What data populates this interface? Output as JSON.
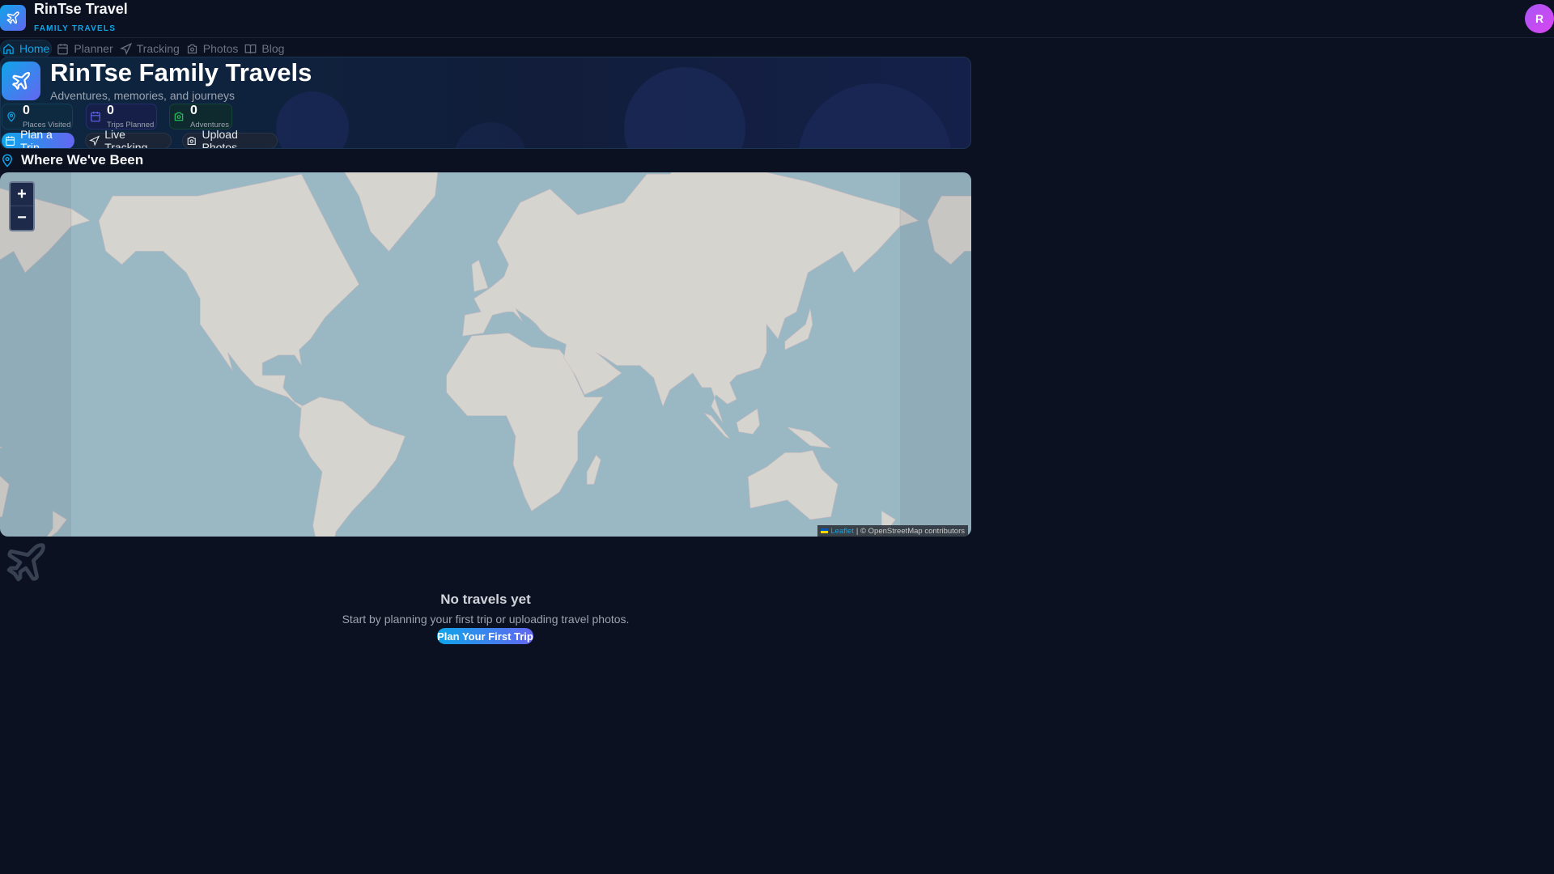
{
  "app": {
    "name": "RinTse Travel",
    "subtitle": "FAMILY TRAVELS",
    "avatar_initial": "R"
  },
  "nav": [
    {
      "label": "Home",
      "icon": "home-icon",
      "active": true
    },
    {
      "label": "Planner",
      "icon": "calendar-icon"
    },
    {
      "label": "Tracking",
      "icon": "navigation-icon"
    },
    {
      "label": "Photos",
      "icon": "camera-icon"
    },
    {
      "label": "Blog",
      "icon": "book-icon"
    }
  ],
  "hero": {
    "title": "RinTse Family Travels",
    "subtitle": "Adventures, memories, and journeys",
    "stats": [
      {
        "value": "0",
        "label": "Places Visited",
        "color": "#0ea5e9"
      },
      {
        "value": "0",
        "label": "Trips Planned",
        "color": "#6366f1"
      },
      {
        "value": "0",
        "label": "Adventures",
        "color": "#22c55e"
      }
    ],
    "buttons": {
      "plan": "Plan a Trip",
      "tracking": "Live Tracking",
      "upload": "Upload Photos"
    }
  },
  "map_section": {
    "title": "Where We've Been",
    "zoom_in": "+",
    "zoom_out": "−",
    "attribution_link": "Leaflet",
    "attribution_text": "| © OpenStreetMap contributors"
  },
  "empty_state": {
    "title": "No travels yet",
    "message": "Start by planning your first trip or uploading travel photos.",
    "button": "Plan Your First Trip"
  }
}
